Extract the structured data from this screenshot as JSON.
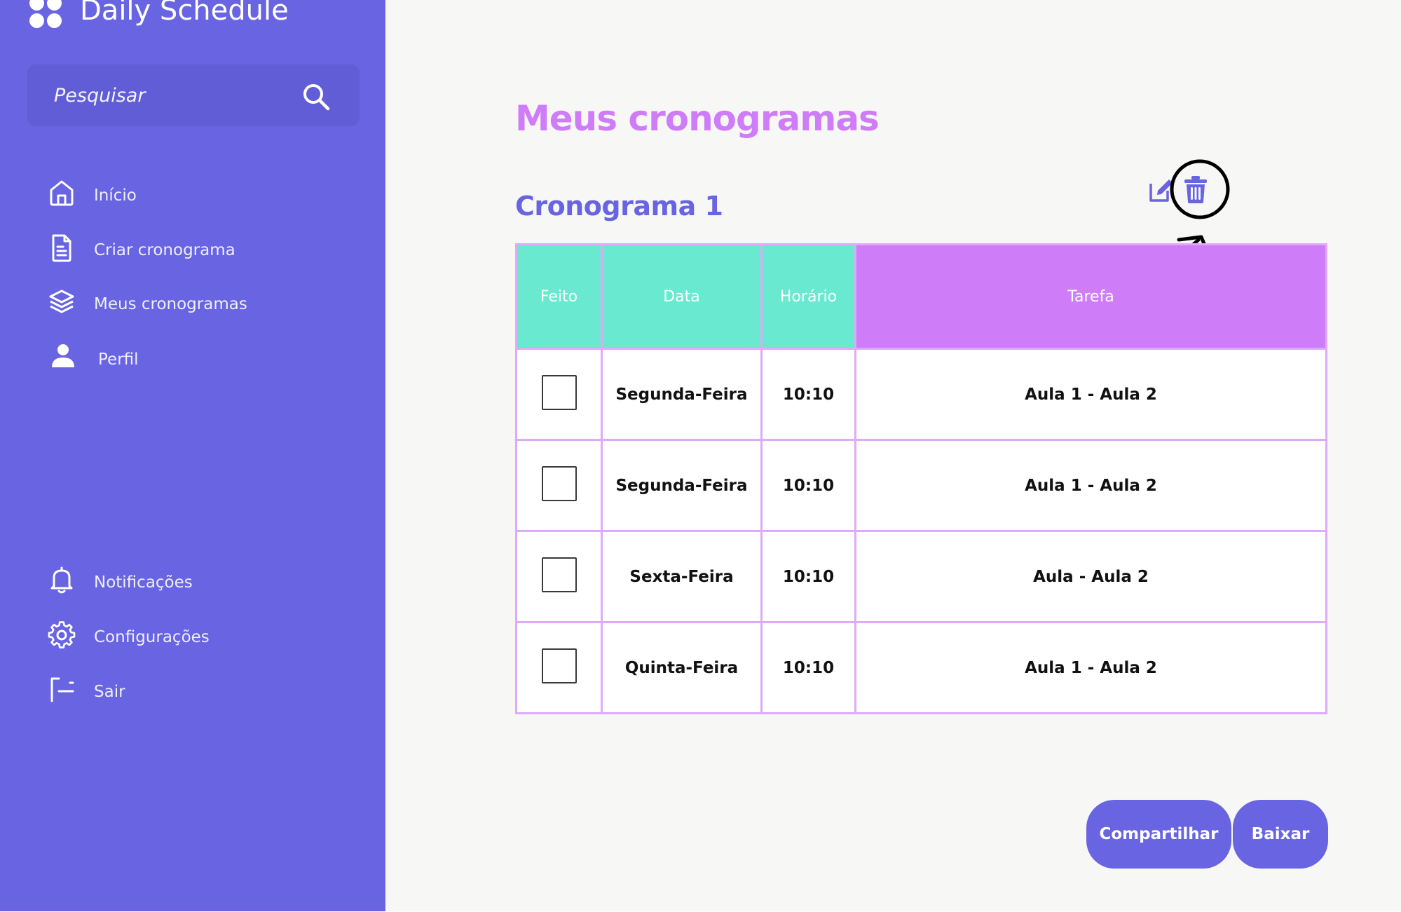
{
  "app": {
    "title": "Daily Schedule",
    "logo_icon": "four-dots-logo-icon"
  },
  "search": {
    "placeholder": "Pesquisar",
    "value": "",
    "icon": "search-icon"
  },
  "sidebar": {
    "items": [
      {
        "label": "Início",
        "icon": "home-icon"
      },
      {
        "label": "Criar cronograma",
        "icon": "document-icon"
      },
      {
        "label": "Meus cronogramas",
        "icon": "layers-icon"
      },
      {
        "label": "Perfil",
        "icon": "user-icon"
      }
    ],
    "bottom_items": [
      {
        "label": "Notificações",
        "icon": "bell-icon"
      },
      {
        "label": "Configurações",
        "icon": "gear-icon"
      },
      {
        "label": "Sair",
        "icon": "logout-icon"
      }
    ]
  },
  "main": {
    "page_title": "Meus cronogramas",
    "schedule": {
      "title": "Cronograma 1",
      "actions": [
        {
          "icon": "edit-icon"
        },
        {
          "icon": "trash-icon"
        }
      ],
      "table": {
        "headers": [
          "Feito",
          "Data",
          "Horário",
          "Tarefa"
        ],
        "rows": [
          {
            "done": false,
            "date": "Segunda-Feira",
            "time": "10:10",
            "task": "Aula 1 - Aula 2"
          },
          {
            "done": false,
            "date": "Segunda-Feira",
            "time": "10:10",
            "task": "Aula 1 - Aula 2"
          },
          {
            "done": false,
            "date": "Sexta-Feira",
            "time": "10:10",
            "task": "Aula - Aula 2"
          },
          {
            "done": false,
            "date": "Quinta-Feira",
            "time": "10:10",
            "task": "Aula 1 - Aula 2"
          }
        ]
      }
    },
    "buttons": {
      "share": "Compartilhar",
      "download": "Baixar"
    }
  },
  "colors": {
    "sidebar": "#6864e2",
    "search_bg": "#615dd6",
    "page_title": "#cf7cf8",
    "section_title": "#6864e2",
    "header_green": "#68e9d0",
    "header_purple": "#cf7cf8",
    "table_border": "#dfaaf7",
    "content_bg": "#f7f7f6",
    "button": "#6864e2"
  }
}
